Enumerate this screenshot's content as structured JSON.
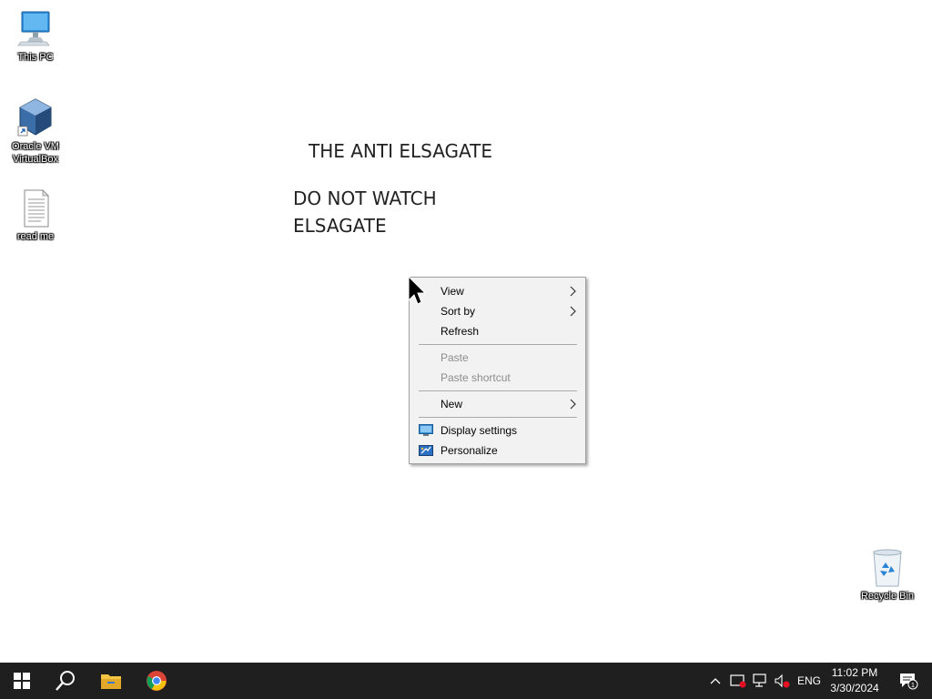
{
  "desktop": {
    "icons": [
      {
        "label": "This PC",
        "icon": "this-pc-icon"
      },
      {
        "label": "Oracle VM VirtualBox",
        "line1": "Oracle VM",
        "line2": "VirtualBox",
        "icon": "virtualbox-icon"
      },
      {
        "label": "read me",
        "icon": "text-file-icon"
      },
      {
        "label": "Recycle Bin",
        "icon": "recycle-bin-icon"
      }
    ],
    "text": {
      "title": "THE ANTI ELSAGATE",
      "line1": "DO NOT WATCH",
      "line2": "ELSAGATE"
    }
  },
  "context_menu": {
    "items": [
      {
        "label": "View",
        "submenu": true,
        "enabled": true
      },
      {
        "label": "Sort by",
        "submenu": true,
        "enabled": true
      },
      {
        "label": "Refresh",
        "submenu": false,
        "enabled": true
      },
      {
        "label": "Paste",
        "submenu": false,
        "enabled": false
      },
      {
        "label": "Paste shortcut",
        "submenu": false,
        "enabled": false
      },
      {
        "label": "New",
        "submenu": true,
        "enabled": true
      },
      {
        "label": "Display settings",
        "submenu": false,
        "enabled": true,
        "icon": "display-settings-icon"
      },
      {
        "label": "Personalize",
        "submenu": false,
        "enabled": true,
        "icon": "personalize-icon"
      }
    ]
  },
  "taskbar": {
    "pinned": [
      "start-icon",
      "search-icon",
      "file-explorer-icon",
      "chrome-icon"
    ],
    "tray": {
      "language": "ENG",
      "time": "11:02 PM",
      "date": "3/30/2024",
      "notification_count": "1"
    }
  },
  "colors": {
    "taskbar_bg": "#1f1f1f",
    "menu_bg": "#f2f2f2",
    "desktop_bg": "#ffffff"
  }
}
